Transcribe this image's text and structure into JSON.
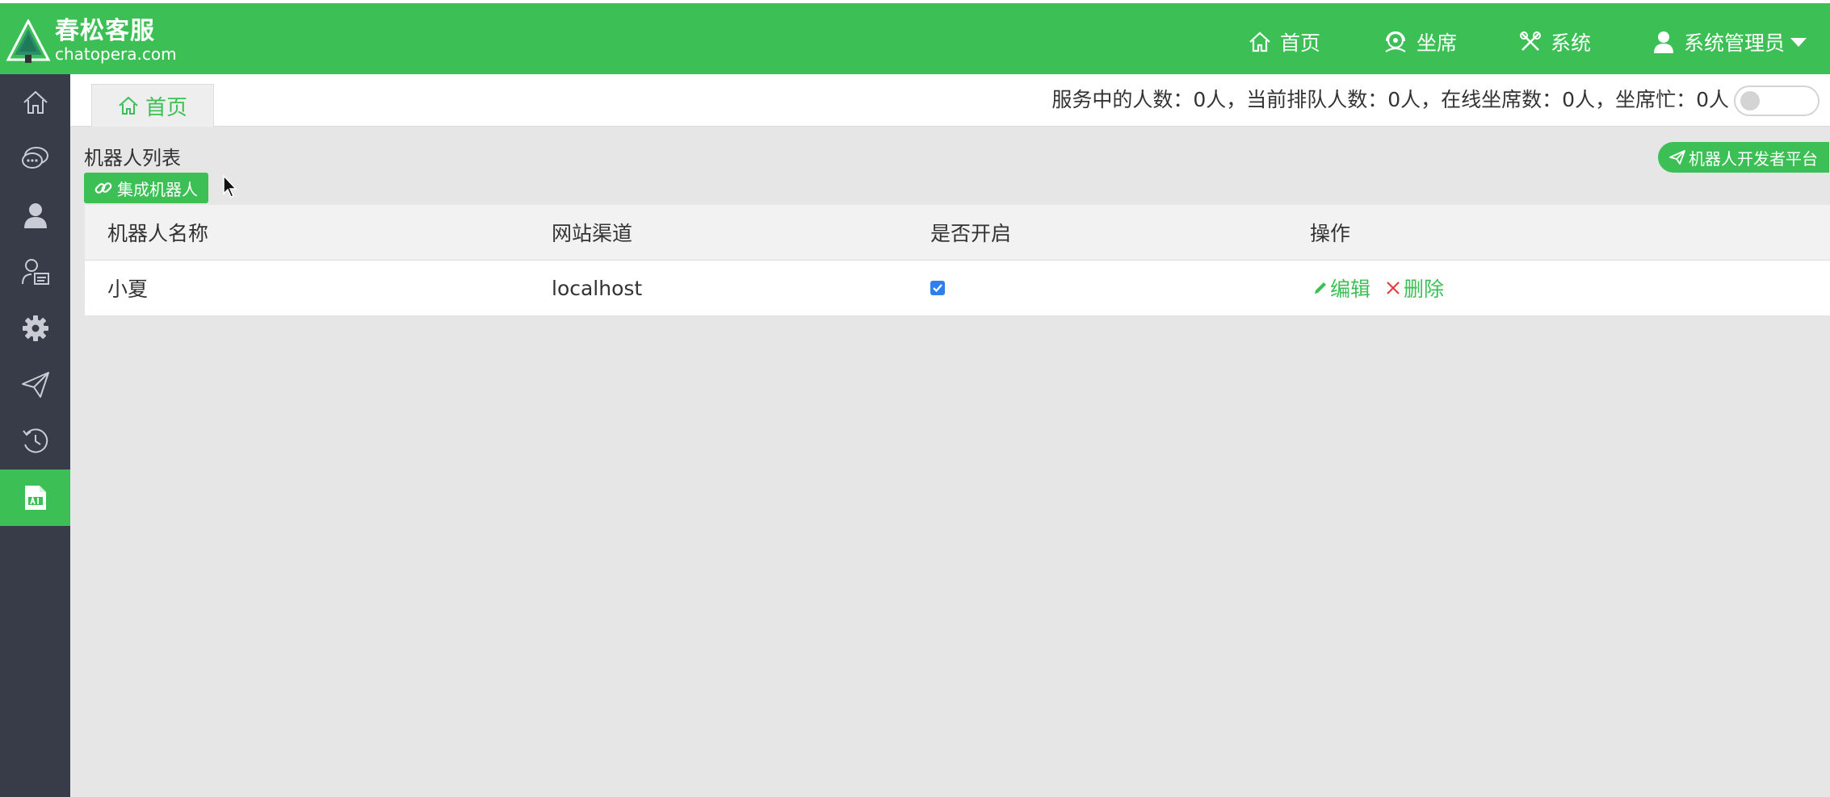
{
  "header": {
    "logo_title": "春松客服",
    "logo_sub": "chatopera.com",
    "nav": [
      {
        "label": "首页",
        "icon": "home-icon"
      },
      {
        "label": "坐席",
        "icon": "headset-icon"
      },
      {
        "label": "系统",
        "icon": "tools-icon"
      }
    ],
    "user_label": "系统管理员"
  },
  "sidebar": {
    "items": [
      {
        "icon": "home-icon"
      },
      {
        "icon": "chat-bubble-icon"
      },
      {
        "icon": "user-icon"
      },
      {
        "icon": "contact-card-icon"
      },
      {
        "icon": "gear-icon"
      },
      {
        "icon": "paper-plane-icon"
      },
      {
        "icon": "history-icon"
      },
      {
        "icon": "ai-document-icon",
        "active": true
      }
    ]
  },
  "tabs": {
    "home_label": "首页"
  },
  "status": {
    "text": "服务中的人数：0人，当前排队人数：0人，在线坐席数：0人，坐席忙：0人",
    "toggle_on": false
  },
  "robot_list": {
    "title": "机器人列表",
    "integrate_button": "集成机器人",
    "dev_platform_button": "机器人开发者平台",
    "columns": [
      "机器人名称",
      "网站渠道",
      "是否开启",
      "操作"
    ],
    "rows": [
      {
        "name": "小夏",
        "channel": "localhost",
        "enabled": true,
        "edit_label": "编辑",
        "delete_label": "删除"
      }
    ]
  },
  "colors": {
    "brand_green": "#3cc055",
    "sidebar_dark": "#383c48",
    "danger_red": "#e53935",
    "checkbox_blue": "#2f80ed"
  }
}
